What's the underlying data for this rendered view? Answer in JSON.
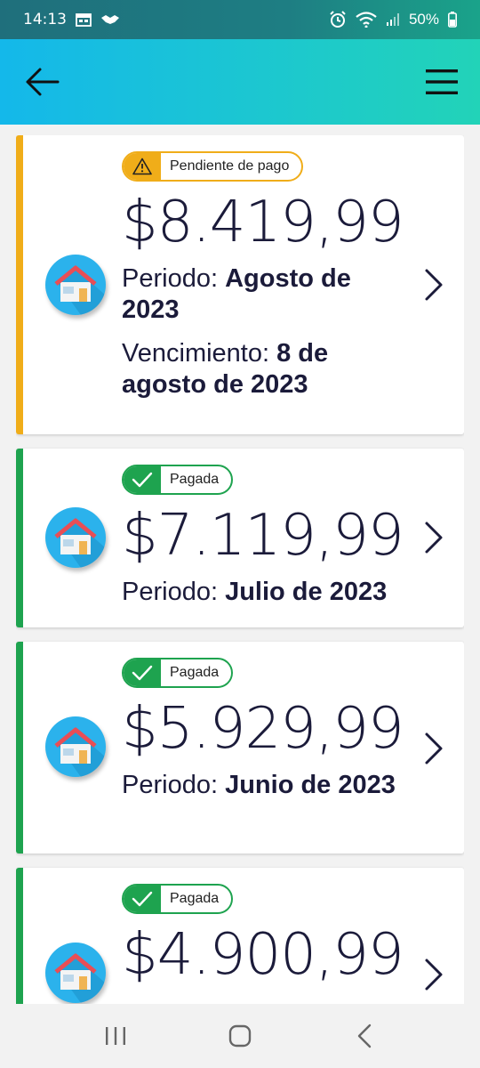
{
  "status_bar": {
    "time": "14:13",
    "battery": "50%"
  },
  "header": {
    "back_icon": "arrow-left-icon",
    "menu_icon": "hamburger-menu-icon"
  },
  "colors": {
    "pending": "#f0ad19",
    "paid": "#1ea34f",
    "header_start": "#14b8ea",
    "header_end": "#22d3b8"
  },
  "bills": [
    {
      "status": "pending",
      "badge_label": "Pendiente de pago",
      "badge_icon": "warning-triangle-icon",
      "amount": "$8.419,99",
      "period_label": "Periodo: ",
      "period_value": "Agosto de 2023",
      "due_label": "Vencimiento: ",
      "due_value": "8 de agosto de 2023"
    },
    {
      "status": "paid",
      "badge_label": "Pagada",
      "badge_icon": "checkmark-icon",
      "amount": "$7.119,99",
      "period_label": "Periodo: ",
      "period_value": "Julio de 2023"
    },
    {
      "status": "paid",
      "badge_label": "Pagada",
      "badge_icon": "checkmark-icon",
      "amount": "$5.929,99",
      "period_label": "Periodo: ",
      "period_value": "Junio de 2023"
    },
    {
      "status": "paid",
      "badge_label": "Pagada",
      "badge_icon": "checkmark-icon",
      "amount": "$4.900,99"
    }
  ]
}
